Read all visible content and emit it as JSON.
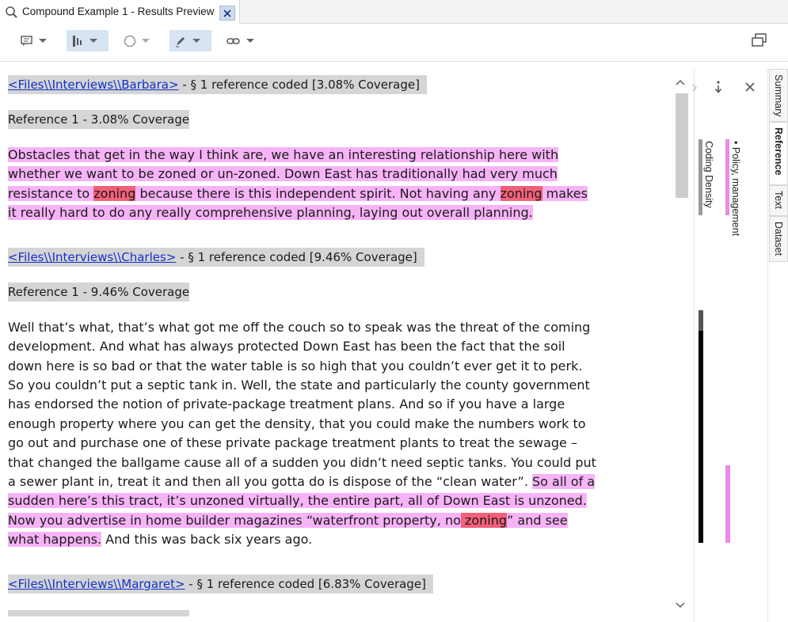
{
  "tab": {
    "title": "Compound Example 1 - Results Preview",
    "close": "✕"
  },
  "toolbar": {
    "items": [
      "annotation",
      "coding-stripes",
      "highlight",
      "edit",
      "links"
    ],
    "restore": "restore"
  },
  "doc": {
    "barbara": {
      "link": "<Files\\\\Interviews\\\\Barbara>",
      "meta": " - § 1 reference coded  [3.08% Coverage]"
    },
    "barbara_ref": "Reference 1 - 3.08% Coverage ",
    "p1": {
      "l1": "Obstacles that get in the way I think are, we have an interesting relationship here with",
      "l2": "whether we want to be zoned or un-zoned. Down East has traditionally had very much",
      "l3a": "resistance to ",
      "l3b": "zoning",
      "l3c": " because there is this independent spirit. Not having any ",
      "l3d": "zoning",
      "l3e": " makes",
      "l4": "it really hard to do any really comprehensive planning, laying out overall planning."
    },
    "charles": {
      "link": "<Files\\\\Interviews\\\\Charles>",
      "meta": " - § 1 reference coded  [9.46% Coverage]"
    },
    "charles_ref": "Reference 1 - 9.46% Coverage ",
    "p2": {
      "l1": "Well that’s what, that’s what got me off the couch so to speak was the threat of the coming",
      "l2": "development. And what has always protected Down East has been the fact that the soil",
      "l3": "down here is so bad or that the water table is so high that you couldn’t ever get it to perk.",
      "l4": "So you couldn’t put a septic tank in. Well, the state and particularly the county government",
      "l5": "has endorsed the notion of private-package treatment plans. And so if you have a large",
      "l6": "enough property where you can get the density, that you could make the numbers work to",
      "l7": "go out and purchase one of these private package treatment plants to treat the sewage –",
      "l8": "that changed the ballgame cause all of a sudden you didn’t need septic tanks. You could put",
      "l9a": "a sewer plant in, treat it and then all you gotta do is dispose of the “clean water”. ",
      "l9b": "So all of a",
      "l10": "sudden here’s this tract, it’s unzoned virtually, the entire part, all of Down East is unzoned.",
      "l11a": "Now you advertise in home builder magazines “waterfront property, no",
      "l11b": " zoning",
      "l11c": "” and see",
      "l12a": "what happens.",
      "l12b": " And this was back six years ago."
    },
    "margaret": {
      "link": "<Files\\\\Interviews\\\\Margaret>",
      "meta": " - § 1 reference coded  [6.83% Coverage]"
    }
  },
  "stripes": {
    "node": "Policy, management",
    "density": "Coding Density",
    "colors": {
      "node": "#e98be9",
      "density": "#000000",
      "density_header": "#999999"
    }
  },
  "sidetabs": [
    "Summary",
    "Reference",
    "Text",
    "Dataset"
  ]
}
